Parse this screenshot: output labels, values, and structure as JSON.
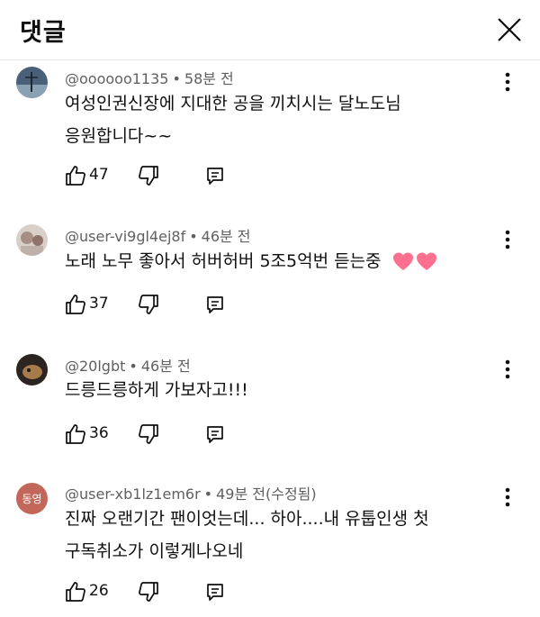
{
  "header": {
    "title": "댓글",
    "close_icon": "close-icon"
  },
  "comments": [
    {
      "author": "@oooooo1135",
      "time": "58분 전",
      "lines": [
        "여성인권신장에 지대한 공을 끼치시는 달노도님",
        "응원합니다~~"
      ],
      "likes": "47",
      "avatar_color": "#6d8297"
    },
    {
      "author": "@user-vi9gl4ej8f",
      "time": "46분 전",
      "lines": [
        "노래 노무 좋아서 허버허버 5조5억번 듣는중"
      ],
      "likes": "37",
      "emoji": "heart-icons",
      "avatar_color": "#b9a9a2"
    },
    {
      "author": "@20lgbt",
      "time": "46분 전",
      "lines": [
        "드릉드릉하게 가보자고!!!"
      ],
      "likes": "36",
      "avatar_color": "#5b4a3a"
    },
    {
      "author": "@user-xb1lz1em6r",
      "time": "49분 전(수정됨)",
      "lines": [
        "진짜 오랜기간 팬이엇는데... 하아....내 유툽인생 첫",
        "구독취소가 이렇게나오네"
      ],
      "likes": "26",
      "avatar_text": "동영",
      "avatar_color": "#c3675a"
    }
  ],
  "colors": {
    "meta_text": "#606060",
    "divider": "#e5e5e5",
    "heart": "#ff6f8f"
  }
}
